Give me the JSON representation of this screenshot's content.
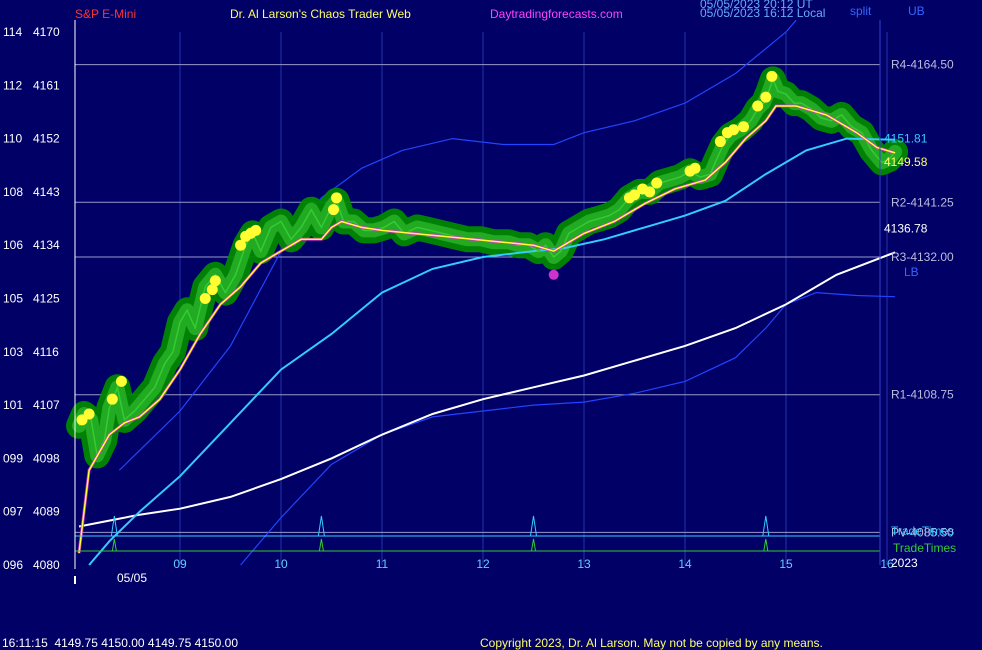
{
  "header": {
    "symbol": "S&P E-Mini",
    "author": "Dr. Al Larson's Chaos Trader Web",
    "site": "Daytradingforecasts.com",
    "timestamp_utc": "05/05/2023 20:12 UT",
    "timestamp_local": "05/05/2023 16:12 Local",
    "corner": "split",
    "corner_tag": "UB"
  },
  "footer": {
    "quote": "16:11:15  4149.75 4150.00 4149.75 4150.00",
    "copyright": "Copyright 2023, Dr. Al Larson. May not be copied by any means."
  },
  "colors": {
    "background": "#000066",
    "price": "#33cc33",
    "price_glow": "#008800",
    "ema_fast": "#ffff33",
    "ema_magenta": "#cc33cc",
    "ema_cyan": "#33ccff",
    "ema_white": "#ffffff",
    "band": "#2244ff",
    "pivot_line": "#9999cc",
    "tradetimes_cyan": "#33ccff",
    "tradetimes_green": "#33cc33"
  },
  "chart_data": {
    "type": "line",
    "title": "S&P E-Mini",
    "x_axis": {
      "type": "time",
      "date_label": "05/05",
      "year_label": "2023",
      "ticks": [
        {
          "t": 9,
          "label": "09"
        },
        {
          "t": 10,
          "label": "10"
        },
        {
          "t": 11,
          "label": "11"
        },
        {
          "t": 12,
          "label": "12"
        },
        {
          "t": 13,
          "label": "13"
        },
        {
          "t": 14,
          "label": "14"
        },
        {
          "t": 15,
          "label": "15"
        },
        {
          "t": 16,
          "label": "16"
        }
      ],
      "range": [
        8.0,
        16.08
      ]
    },
    "y_axis": {
      "range": [
        4080,
        4170
      ],
      "ticks": [
        {
          "v": 4170,
          "left": "114"
        },
        {
          "v": 4161,
          "left": "112"
        },
        {
          "v": 4152,
          "left": "110"
        },
        {
          "v": 4143,
          "left": "108"
        },
        {
          "v": 4134,
          "left": "106"
        },
        {
          "v": 4125,
          "left": "105"
        },
        {
          "v": 4116,
          "left": "103"
        },
        {
          "v": 4107,
          "left": "101"
        },
        {
          "v": 4098,
          "left": "099"
        },
        {
          "v": 4089,
          "left": "097"
        },
        {
          "v": 4080,
          "left": "096"
        }
      ]
    },
    "levels": [
      {
        "label": "R4-4164.50",
        "value": 4164.5
      },
      {
        "label": "R2-4141.25",
        "value": 4141.25
      },
      {
        "label": "R3-4132.00",
        "value": 4132.0
      },
      {
        "label": "R1-4108.75",
        "value": 4108.75
      },
      {
        "label": "PV-4085.50",
        "value": 4085.5
      }
    ],
    "value_labels": [
      {
        "label": "4151.81",
        "value": 4151.81,
        "series": "cyan"
      },
      {
        "label": "4149.58",
        "value": 4149.58,
        "series": "price"
      },
      {
        "label": "4136.78",
        "value": 4136.78,
        "series": "white"
      }
    ],
    "band_labels": {
      "upper": "UB",
      "lower": "LB"
    },
    "tradetimes": {
      "label": "TradeTimes",
      "times": [
        8.35,
        10.4,
        12.5,
        14.8
      ]
    },
    "series": [
      {
        "name": "price",
        "points": [
          [
            8.0,
            4103.5
          ],
          [
            8.05,
            4105.5
          ],
          [
            8.12,
            4104.5
          ],
          [
            8.18,
            4098.5
          ],
          [
            8.25,
            4101
          ],
          [
            8.3,
            4106.5
          ],
          [
            8.38,
            4110
          ],
          [
            8.45,
            4104.5
          ],
          [
            8.55,
            4106
          ],
          [
            8.65,
            4108
          ],
          [
            8.75,
            4110
          ],
          [
            8.85,
            4114
          ],
          [
            8.93,
            4116
          ],
          [
            9.0,
            4121
          ],
          [
            9.07,
            4123
          ],
          [
            9.15,
            4120
          ],
          [
            9.25,
            4127
          ],
          [
            9.35,
            4129
          ],
          [
            9.45,
            4126
          ],
          [
            9.55,
            4129
          ],
          [
            9.65,
            4134
          ],
          [
            9.72,
            4136
          ],
          [
            9.8,
            4133
          ],
          [
            9.9,
            4137
          ],
          [
            10.0,
            4138
          ],
          [
            10.1,
            4135
          ],
          [
            10.2,
            4137
          ],
          [
            10.3,
            4140
          ],
          [
            10.4,
            4137
          ],
          [
            10.5,
            4140.5
          ],
          [
            10.55,
            4141.5
          ],
          [
            10.62,
            4138
          ],
          [
            10.72,
            4138
          ],
          [
            10.82,
            4136.5
          ],
          [
            10.92,
            4136.5
          ],
          [
            11.02,
            4137
          ],
          [
            11.12,
            4138
          ],
          [
            11.22,
            4136
          ],
          [
            11.35,
            4137
          ],
          [
            11.48,
            4136.5
          ],
          [
            11.6,
            4136
          ],
          [
            11.72,
            4135.5
          ],
          [
            11.85,
            4135
          ],
          [
            11.98,
            4135
          ],
          [
            12.1,
            4134.5
          ],
          [
            12.25,
            4134.5
          ],
          [
            12.35,
            4134
          ],
          [
            12.45,
            4134
          ],
          [
            12.55,
            4133
          ],
          [
            12.62,
            4134
          ],
          [
            12.7,
            4132
          ],
          [
            12.77,
            4133
          ],
          [
            12.85,
            4136
          ],
          [
            12.95,
            4137
          ],
          [
            13.05,
            4138
          ],
          [
            13.15,
            4138.5
          ],
          [
            13.25,
            4139
          ],
          [
            13.35,
            4140
          ],
          [
            13.45,
            4142
          ],
          [
            13.55,
            4143
          ],
          [
            13.65,
            4143
          ],
          [
            13.75,
            4144.5
          ],
          [
            13.85,
            4145
          ],
          [
            13.95,
            4145.5
          ],
          [
            14.05,
            4146.5
          ],
          [
            14.15,
            4145.5
          ],
          [
            14.25,
            4146
          ],
          [
            14.3,
            4148
          ],
          [
            14.38,
            4151
          ],
          [
            14.45,
            4152.5
          ],
          [
            14.55,
            4153.5
          ],
          [
            14.65,
            4155
          ],
          [
            14.72,
            4157
          ],
          [
            14.78,
            4158
          ],
          [
            14.83,
            4160
          ],
          [
            14.87,
            4162
          ],
          [
            14.92,
            4160
          ],
          [
            15.0,
            4159.5
          ],
          [
            15.08,
            4158
          ],
          [
            15.15,
            4158
          ],
          [
            15.25,
            4157
          ],
          [
            15.35,
            4155.5
          ],
          [
            15.45,
            4155
          ],
          [
            15.55,
            4156
          ],
          [
            15.65,
            4154
          ],
          [
            15.75,
            4153
          ],
          [
            15.85,
            4150
          ],
          [
            15.95,
            4148
          ],
          [
            16.02,
            4148.5
          ],
          [
            16.08,
            4149.75
          ]
        ]
      },
      {
        "name": "ema_fast",
        "points": [
          [
            8.0,
            4082
          ],
          [
            8.1,
            4096
          ],
          [
            8.2,
            4099
          ],
          [
            8.3,
            4102
          ],
          [
            8.45,
            4104
          ],
          [
            8.6,
            4105
          ],
          [
            8.8,
            4108
          ],
          [
            9.0,
            4113
          ],
          [
            9.2,
            4119
          ],
          [
            9.4,
            4124
          ],
          [
            9.6,
            4127
          ],
          [
            9.8,
            4131
          ],
          [
            10.0,
            4133
          ],
          [
            10.2,
            4135
          ],
          [
            10.4,
            4135
          ],
          [
            10.5,
            4137
          ],
          [
            10.6,
            4138
          ],
          [
            10.8,
            4137
          ],
          [
            11.0,
            4136.5
          ],
          [
            11.3,
            4136
          ],
          [
            11.6,
            4135.5
          ],
          [
            11.9,
            4135
          ],
          [
            12.2,
            4134.5
          ],
          [
            12.5,
            4134
          ],
          [
            12.7,
            4133
          ],
          [
            12.8,
            4134
          ],
          [
            13.0,
            4136
          ],
          [
            13.3,
            4138
          ],
          [
            13.6,
            4141
          ],
          [
            13.9,
            4143.5
          ],
          [
            14.2,
            4145
          ],
          [
            14.4,
            4148
          ],
          [
            14.6,
            4152
          ],
          [
            14.8,
            4155
          ],
          [
            14.9,
            4157.5
          ],
          [
            15.1,
            4157.5
          ],
          [
            15.4,
            4156
          ],
          [
            15.7,
            4153
          ],
          [
            15.9,
            4150.5
          ],
          [
            16.08,
            4149.58
          ]
        ]
      },
      {
        "name": "ema_cyan",
        "points": [
          [
            8.1,
            4080
          ],
          [
            8.3,
            4084
          ],
          [
            8.6,
            4089
          ],
          [
            9.0,
            4095
          ],
          [
            9.5,
            4104
          ],
          [
            10.0,
            4113
          ],
          [
            10.5,
            4119
          ],
          [
            11.0,
            4126
          ],
          [
            11.5,
            4130
          ],
          [
            12.0,
            4132
          ],
          [
            12.5,
            4133
          ],
          [
            12.8,
            4133.5
          ],
          [
            13.2,
            4135
          ],
          [
            13.6,
            4137
          ],
          [
            14.0,
            4139
          ],
          [
            14.4,
            4141.5
          ],
          [
            14.8,
            4146
          ],
          [
            15.2,
            4150
          ],
          [
            15.6,
            4152
          ],
          [
            16.08,
            4151.81
          ]
        ]
      },
      {
        "name": "ema_white",
        "points": [
          [
            8.0,
            4086.5
          ],
          [
            8.3,
            4087.5
          ],
          [
            8.6,
            4088.5
          ],
          [
            9.0,
            4089.5
          ],
          [
            9.5,
            4091.5
          ],
          [
            10.0,
            4094.5
          ],
          [
            10.5,
            4098
          ],
          [
            11.0,
            4102
          ],
          [
            11.5,
            4105.5
          ],
          [
            12.0,
            4108
          ],
          [
            12.5,
            4110
          ],
          [
            13.0,
            4112
          ],
          [
            13.5,
            4114.5
          ],
          [
            14.0,
            4117
          ],
          [
            14.5,
            4120
          ],
          [
            15.0,
            4124
          ],
          [
            15.5,
            4129
          ],
          [
            16.08,
            4132.8
          ]
        ]
      },
      {
        "name": "upper_band",
        "points": [
          [
            8.4,
            4096
          ],
          [
            8.7,
            4101
          ],
          [
            9.0,
            4106
          ],
          [
            9.5,
            4117
          ],
          [
            10.0,
            4133
          ],
          [
            10.4,
            4142
          ],
          [
            10.8,
            4147
          ],
          [
            11.2,
            4150
          ],
          [
            11.7,
            4152
          ],
          [
            12.2,
            4151
          ],
          [
            12.7,
            4151
          ],
          [
            13.0,
            4153
          ],
          [
            13.5,
            4155
          ],
          [
            14.0,
            4158
          ],
          [
            14.5,
            4163
          ],
          [
            15.0,
            4170
          ],
          [
            15.1,
            4172
          ]
        ]
      },
      {
        "name": "lower_band",
        "points": [
          [
            9.6,
            4080
          ],
          [
            10.0,
            4088
          ],
          [
            10.5,
            4097
          ],
          [
            11.0,
            4102
          ],
          [
            11.5,
            4105
          ],
          [
            12.0,
            4106
          ],
          [
            12.5,
            4107
          ],
          [
            13.0,
            4107.5
          ],
          [
            13.5,
            4109
          ],
          [
            14.0,
            4111
          ],
          [
            14.5,
            4115
          ],
          [
            14.8,
            4120
          ],
          [
            15.0,
            4124
          ],
          [
            15.3,
            4126
          ],
          [
            15.7,
            4125.5
          ],
          [
            16.08,
            4125.3
          ]
        ]
      }
    ],
    "markers": {
      "yellow_dots": [
        [
          8.03,
          4104.5
        ],
        [
          8.1,
          4105.5
        ],
        [
          8.33,
          4108
        ],
        [
          8.42,
          4111
        ],
        [
          9.25,
          4125
        ],
        [
          9.32,
          4126.5
        ],
        [
          9.35,
          4128
        ],
        [
          9.6,
          4134
        ],
        [
          9.65,
          4135.5
        ],
        [
          9.7,
          4136
        ],
        [
          9.75,
          4136.5
        ],
        [
          10.52,
          4140
        ],
        [
          10.55,
          4142
        ],
        [
          13.45,
          4142
        ],
        [
          13.5,
          4142.5
        ],
        [
          13.58,
          4143.5
        ],
        [
          13.65,
          4143
        ],
        [
          13.72,
          4144.5
        ],
        [
          14.05,
          4146.5
        ],
        [
          14.1,
          4147
        ],
        [
          14.35,
          4151.5
        ],
        [
          14.42,
          4153
        ],
        [
          14.48,
          4153.5
        ],
        [
          14.58,
          4154
        ],
        [
          14.72,
          4157.5
        ],
        [
          14.8,
          4159
        ],
        [
          14.86,
          4162.5
        ]
      ],
      "magenta_dot": [
        12.7,
        4129
      ]
    }
  }
}
